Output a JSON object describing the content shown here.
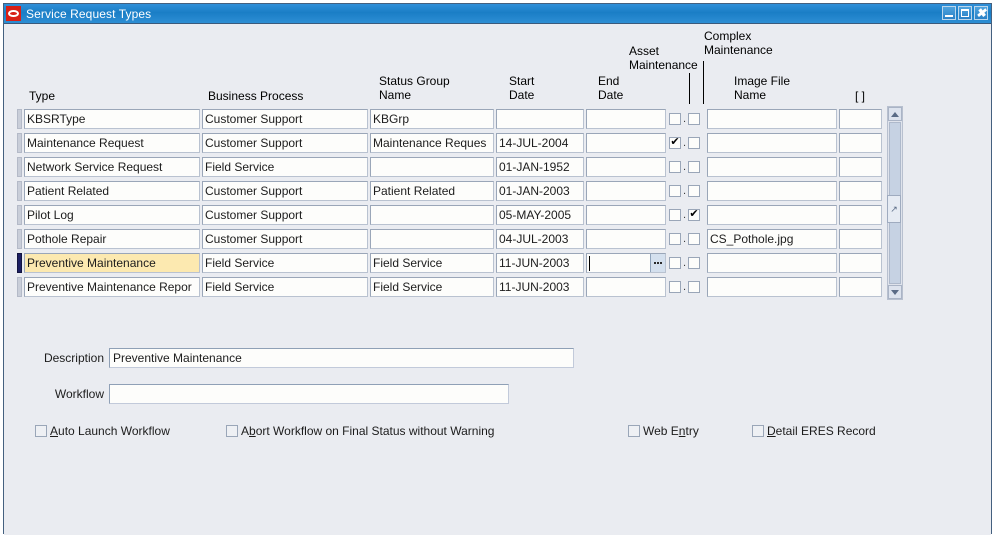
{
  "window": {
    "title": "Service Request Types",
    "logo_icon": "oracle-logo",
    "buttons": {
      "minimize": "minimize-icon",
      "maximize": "maximize-icon",
      "close": "✖"
    }
  },
  "grid": {
    "columns": [
      {
        "key": "type",
        "label": "Type"
      },
      {
        "key": "business_process",
        "label": "Business Process"
      },
      {
        "key": "status_group_name",
        "label": "Status Group\nName"
      },
      {
        "key": "start_date",
        "label": "Start\nDate"
      },
      {
        "key": "end_date",
        "label": "End\nDate"
      },
      {
        "key": "asset_maintenance",
        "label": "Asset\nMaintenance"
      },
      {
        "key": "complex_maintenance",
        "label": "Complex\nMaintenance"
      },
      {
        "key": "image_file_name",
        "label": "Image File\nName"
      },
      {
        "key": "flex",
        "label": "[  ]"
      }
    ],
    "rows": [
      {
        "type": "KBSRType",
        "business_process": "Customer Support",
        "status_group_name": "KBGrp",
        "start_date": "",
        "end_date": "",
        "asset_maintenance": false,
        "complex_maintenance": false,
        "image_file_name": "",
        "flex": "",
        "current": false
      },
      {
        "type": "Maintenance Request",
        "business_process": "Customer Support",
        "status_group_name": "Maintenance Reques",
        "start_date": "14-JUL-2004",
        "end_date": "",
        "asset_maintenance": true,
        "complex_maintenance": false,
        "image_file_name": "",
        "flex": "",
        "current": false
      },
      {
        "type": "Network Service Request",
        "business_process": "Field Service",
        "status_group_name": "",
        "start_date": "01-JAN-1952",
        "end_date": "",
        "asset_maintenance": false,
        "complex_maintenance": false,
        "image_file_name": "",
        "flex": "",
        "current": false
      },
      {
        "type": "Patient Related",
        "business_process": "Customer Support",
        "status_group_name": "Patient Related",
        "start_date": "01-JAN-2003",
        "end_date": "",
        "asset_maintenance": false,
        "complex_maintenance": false,
        "image_file_name": "",
        "flex": "",
        "current": false
      },
      {
        "type": "Pilot Log",
        "business_process": "Customer Support",
        "status_group_name": "",
        "start_date": "05-MAY-2005",
        "end_date": "",
        "asset_maintenance": false,
        "complex_maintenance": true,
        "image_file_name": "",
        "flex": "",
        "current": false
      },
      {
        "type": "Pothole Repair",
        "business_process": "Customer Support",
        "status_group_name": "",
        "start_date": "04-JUL-2003",
        "end_date": "",
        "asset_maintenance": false,
        "complex_maintenance": false,
        "image_file_name": "CS_Pothole.jpg",
        "flex": "",
        "current": false
      },
      {
        "type": "Preventive Maintenance",
        "business_process": "Field Service",
        "status_group_name": "Field Service",
        "start_date": "11-JUN-2003",
        "end_date": "",
        "asset_maintenance": false,
        "complex_maintenance": false,
        "image_file_name": "",
        "flex": "",
        "current": true,
        "end_date_has_lov": true
      },
      {
        "type": "Preventive Maintenance Repor",
        "business_process": "Field Service",
        "status_group_name": "Field Service",
        "start_date": "11-JUN-2003",
        "end_date": "",
        "asset_maintenance": false,
        "complex_maintenance": false,
        "image_file_name": "",
        "flex": "",
        "current": false
      }
    ],
    "scrollbar": {
      "up_icon": "scroll-up-arrow-icon",
      "down_icon": "scroll-down-arrow-icon",
      "grip_icon": "resize-grip-icon"
    }
  },
  "detail": {
    "description_label": "Description",
    "description_value": "Preventive Maintenance",
    "workflow_label": "Workflow",
    "workflow_value": "",
    "checkboxes": [
      {
        "name": "auto-launch-workflow",
        "label_pre": "",
        "mnemonic": "A",
        "label_post": "uto Launch Workflow",
        "checked": false
      },
      {
        "name": "abort-workflow-on-final-status",
        "label_pre": "A",
        "mnemonic": "b",
        "label_post": "ort Workflow on Final Status without Warning",
        "checked": false
      },
      {
        "name": "web-entry",
        "label_pre": "Web E",
        "mnemonic": "n",
        "label_post": "try",
        "checked": false
      },
      {
        "name": "detail-eres-record",
        "label_pre": "",
        "mnemonic": "D",
        "label_post": "etail ERES Record",
        "checked": false
      }
    ]
  },
  "colors": {
    "title_bar": "#1a7ec6",
    "canvas": "#eaecf1",
    "current_row_highlight": "#fce9b0",
    "record_indicator": "#1c1f63",
    "field_bg": "#fdfdfb"
  }
}
